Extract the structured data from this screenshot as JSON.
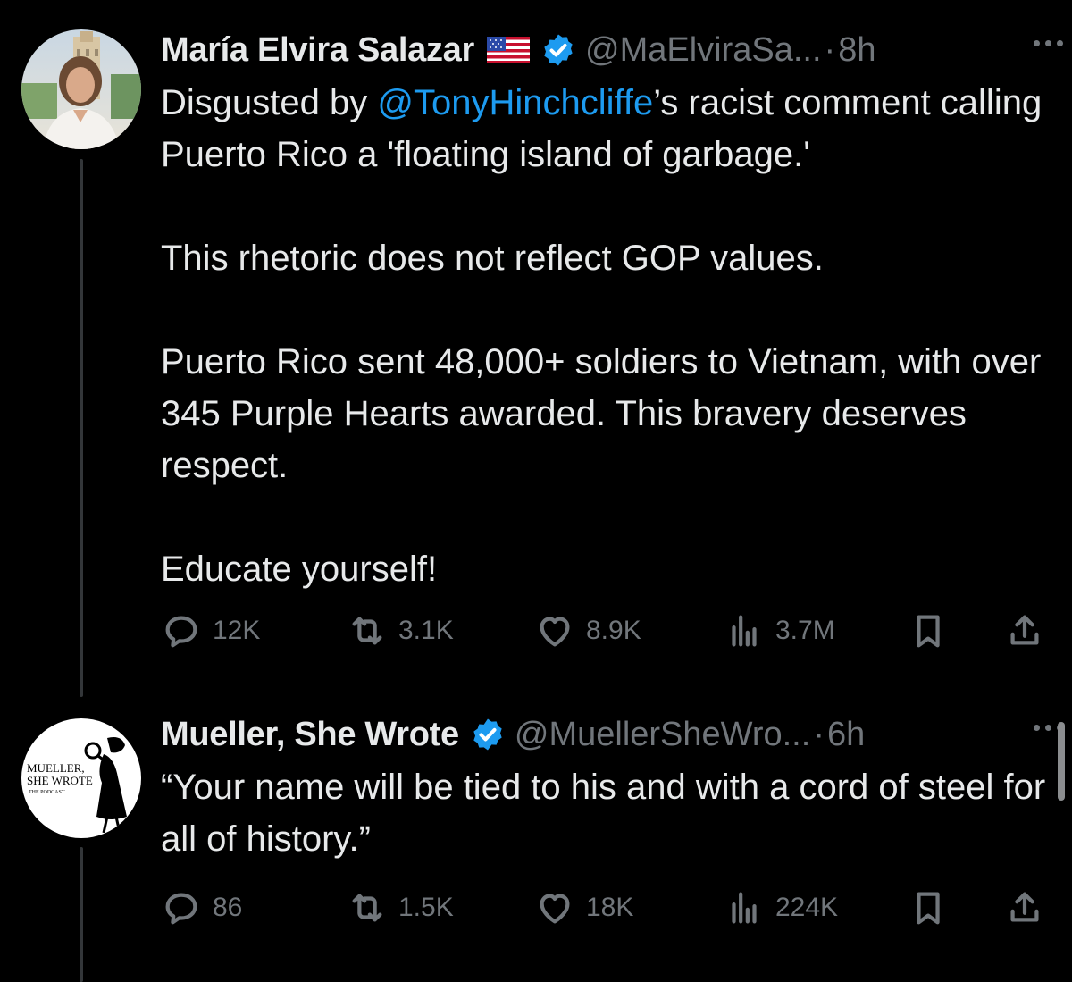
{
  "tweets": [
    {
      "author": {
        "name": "María Elvira Salazar",
        "handle": "@MaElviraSa...",
        "time": "8h"
      },
      "text": {
        "line1_prefix": "Disgusted by ",
        "mention": "@TonyHinchcliffe",
        "line1_suffix": "’s racist comment calling Puerto Rico a 'floating island of garbage.'",
        "paragraph2": "This rhetoric does not reflect GOP values.",
        "paragraph3": "Puerto Rico sent 48,000+ soldiers to Vietnam, with over 345 Purple Hearts awarded. This bravery deserves respect.",
        "paragraph4": "Educate yourself!"
      },
      "stats": {
        "replies": "12K",
        "reposts": "3.1K",
        "likes": "8.9K",
        "views": "3.7M"
      }
    },
    {
      "author": {
        "name": "Mueller, She Wrote",
        "handle": "@MuellerSheWro...",
        "time": "6h",
        "avatar_text_1": "MUELLER,",
        "avatar_text_2": "SHE WROTE",
        "avatar_text_3": "THE PODCAST"
      },
      "text": {
        "paragraph1": "“Your name will be tied to his and with a cord of steel for all of history.”"
      },
      "stats": {
        "replies": "86",
        "reposts": "1.5K",
        "likes": "18K",
        "views": "224K"
      }
    }
  ],
  "separator": "·",
  "colors": {
    "background": "#000000",
    "text_primary": "#e7e9ea",
    "text_secondary": "#71767b",
    "accent": "#1d9bf0",
    "thread_line": "#333639"
  },
  "icons": [
    "reply-icon",
    "repost-icon",
    "like-icon",
    "views-icon",
    "bookmark-icon",
    "share-icon",
    "verified-icon",
    "us-flag-icon",
    "more-icon"
  ]
}
